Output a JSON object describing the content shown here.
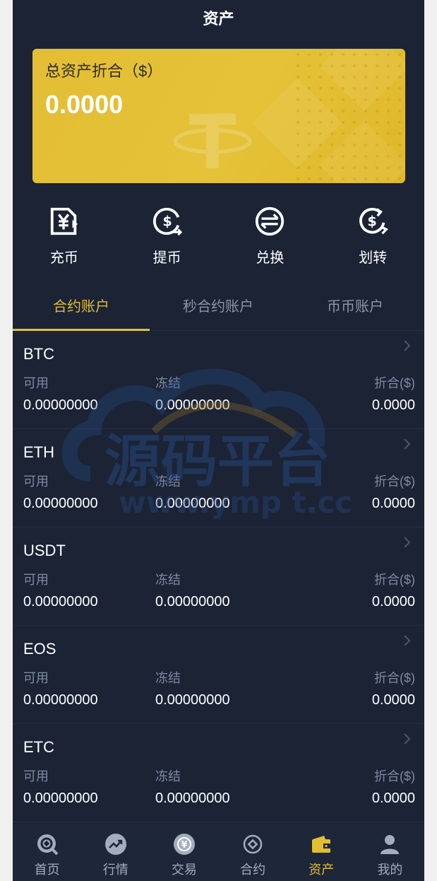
{
  "header": {
    "title": "资产"
  },
  "card": {
    "label": "总资产折合（$）",
    "value": "0.0000"
  },
  "actions": [
    {
      "label": "充币",
      "icon": "deposit-icon"
    },
    {
      "label": "提币",
      "icon": "withdraw-icon"
    },
    {
      "label": "兑换",
      "icon": "exchange-icon"
    },
    {
      "label": "划转",
      "icon": "transfer-icon"
    }
  ],
  "tabs": [
    {
      "label": "合约账户",
      "active": true
    },
    {
      "label": "秒合约账户",
      "active": false
    },
    {
      "label": "币币账户",
      "active": false
    }
  ],
  "columns": {
    "available": "可用",
    "frozen": "冻结",
    "converted": "折合($)"
  },
  "assets": [
    {
      "name": "BTC",
      "available": "0.00000000",
      "frozen": "0.00000000",
      "converted": "0.0000"
    },
    {
      "name": "ETH",
      "available": "0.00000000",
      "frozen": "0.00000000",
      "converted": "0.0000"
    },
    {
      "name": "USDT",
      "available": "0.00000000",
      "frozen": "0.00000000",
      "converted": "0.0000"
    },
    {
      "name": "EOS",
      "available": "0.00000000",
      "frozen": "0.00000000",
      "converted": "0.0000"
    },
    {
      "name": "ETC",
      "available": "0.00000000",
      "frozen": "0.00000000",
      "converted": "0.0000"
    }
  ],
  "watermark": {
    "text_cn": "源码平台",
    "text_en": "www.ymp t.cc"
  },
  "nav": [
    {
      "label": "首页",
      "icon": "home-icon",
      "active": false
    },
    {
      "label": "行情",
      "icon": "market-icon",
      "active": false
    },
    {
      "label": "交易",
      "icon": "trade-icon",
      "active": false
    },
    {
      "label": "合约",
      "icon": "contract-icon",
      "active": false
    },
    {
      "label": "资产",
      "icon": "wallet-icon",
      "active": true
    },
    {
      "label": "我的",
      "icon": "user-icon",
      "active": false
    }
  ],
  "colors": {
    "background": "#1b2335",
    "accent": "#e3be35",
    "muted": "#7e8ba3",
    "page": "#f0f0f0"
  }
}
